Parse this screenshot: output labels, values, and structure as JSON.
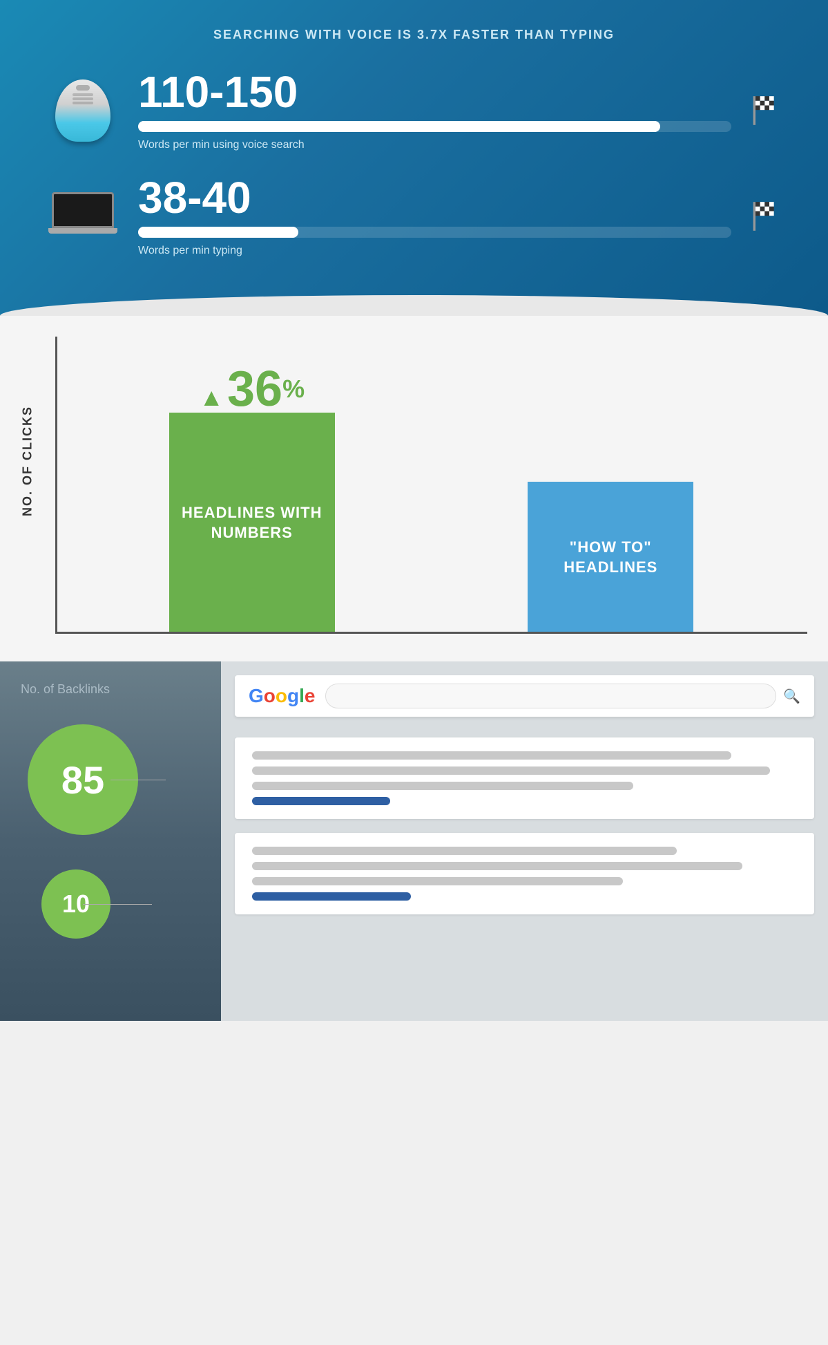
{
  "voice_section": {
    "title": "SEARCHING WITH VOICE IS 3.7x FASTER THAN TYPING",
    "stat1": {
      "number": "110-150",
      "bar_width_pct": 88,
      "label": "Words per min using voice search"
    },
    "stat2": {
      "number": "38-40",
      "bar_width_pct": 27,
      "label": "Words per min typing"
    }
  },
  "chart_section": {
    "yaxis_label": "NO. OF CLICKS",
    "percent_increase": "36",
    "percent_symbol": "%",
    "bar1": {
      "label": "HEADLINES WITH NUMBERS",
      "color": "#6ab04c"
    },
    "bar2": {
      "label": "\"HOW TO\" HEADLINES",
      "color": "#4aa3d8"
    }
  },
  "backlinks_section": {
    "label": "No. of Backlinks",
    "circle1": {
      "number": "85"
    },
    "circle2": {
      "number": "10"
    },
    "google_logo": "Google",
    "result1": {
      "lines": [
        88,
        95,
        70,
        38
      ]
    },
    "result2": {
      "lines": [
        78,
        90,
        68,
        45
      ]
    }
  }
}
